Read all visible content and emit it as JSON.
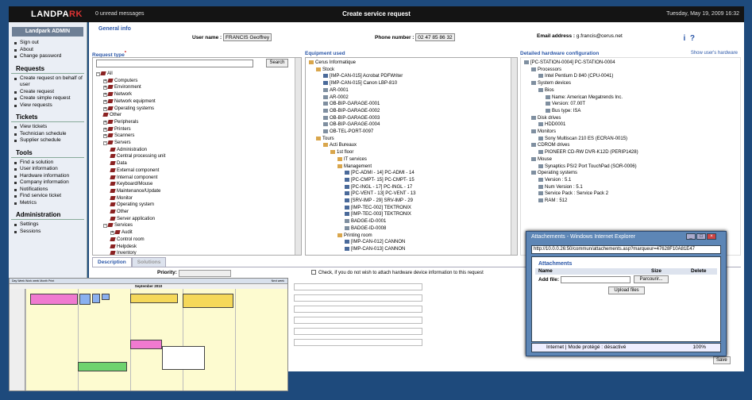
{
  "topbar": {
    "logo_a": "LANDPA",
    "logo_b": "RK",
    "unread": "0 unread messages",
    "title": "Create service request",
    "date": "Tuesday, May 19, 2009",
    "time": "16:32"
  },
  "sidebar": {
    "title": "Landpark ADMIN",
    "account": [
      "Sign out",
      "About",
      "Change password"
    ],
    "requests_title": "Requests",
    "requests": [
      "Create request on behalf of user",
      "Create request",
      "Create simple request",
      "View requests"
    ],
    "tickets_title": "Tickets",
    "tickets": [
      "View tickets",
      "Technician schedule",
      "Supplier schedule"
    ],
    "tools_title": "Tools",
    "tools": [
      "Find a solution",
      "User information",
      "Hardware information",
      "Company information",
      "Notifications",
      "Find service ticket",
      "Metrics"
    ],
    "admin_title": "Administration",
    "admin": [
      "Settings",
      "Sessions"
    ]
  },
  "general": {
    "label": "General info",
    "user_label": "User name :",
    "user_value": "FRANCIS Geoffrey",
    "phone_label": "Phone number :",
    "phone_value": "02 47 85 86 32",
    "email_label": "Email address :",
    "email_value": "g.francis@cerus.net",
    "info_icon": "i",
    "help_icon": "?"
  },
  "request_type": {
    "title": "Request type",
    "required": "*",
    "search_btn": "Search",
    "items": [
      {
        "t": "All",
        "l": 0,
        "pm": "-"
      },
      {
        "t": "Computers",
        "l": 1,
        "pm": "+"
      },
      {
        "t": "Environment",
        "l": 1,
        "pm": "+"
      },
      {
        "t": "Network",
        "l": 1,
        "pm": "+"
      },
      {
        "t": "Network equipment",
        "l": 1,
        "pm": "+"
      },
      {
        "t": "Operating systems",
        "l": 1,
        "pm": "+"
      },
      {
        "t": "Other",
        "l": 1,
        "pm": ""
      },
      {
        "t": "Peripherals",
        "l": 1,
        "pm": "+"
      },
      {
        "t": "Printers",
        "l": 1,
        "pm": "+"
      },
      {
        "t": "Scanners",
        "l": 1,
        "pm": "+"
      },
      {
        "t": "Servers",
        "l": 1,
        "pm": "-"
      },
      {
        "t": "Administration",
        "l": 2,
        "pm": ""
      },
      {
        "t": "Central processing unit",
        "l": 2,
        "pm": ""
      },
      {
        "t": "Data",
        "l": 2,
        "pm": ""
      },
      {
        "t": "External component",
        "l": 2,
        "pm": ""
      },
      {
        "t": "Internal component",
        "l": 2,
        "pm": ""
      },
      {
        "t": "Keyboard/Mouse",
        "l": 2,
        "pm": ""
      },
      {
        "t": "Maintenance/Update",
        "l": 2,
        "pm": ""
      },
      {
        "t": "Monitor",
        "l": 2,
        "pm": ""
      },
      {
        "t": "Operating system",
        "l": 2,
        "pm": ""
      },
      {
        "t": "Other",
        "l": 2,
        "pm": ""
      },
      {
        "t": "Server application",
        "l": 2,
        "pm": ""
      },
      {
        "t": "Services",
        "l": 1,
        "pm": "-"
      },
      {
        "t": "Audit",
        "l": 2,
        "pm": "+"
      },
      {
        "t": "Control room",
        "l": 2,
        "pm": ""
      },
      {
        "t": "Helpdesk",
        "l": 2,
        "pm": ""
      },
      {
        "t": "Inventory",
        "l": 2,
        "pm": ""
      }
    ]
  },
  "equipment": {
    "title": "Equipment used",
    "items": [
      {
        "t": "Cerus Informatique",
        "l": 0,
        "ic": "fold"
      },
      {
        "t": "Stock",
        "l": 1,
        "ic": "fold"
      },
      {
        "t": "[IMP-CAN-015] Acrobat PDFWriter",
        "l": 2,
        "ic": "pc"
      },
      {
        "t": "[IMP-CAN-015] Canon LBP-810",
        "l": 2,
        "ic": "pc"
      },
      {
        "t": "AR-0001",
        "l": 2,
        "ic": "hw"
      },
      {
        "t": "AR-0002",
        "l": 2,
        "ic": "hw"
      },
      {
        "t": "OB-BIP-GARAGE-0001",
        "l": 2,
        "ic": "hw"
      },
      {
        "t": "OB-BIP-GARAGE-0002",
        "l": 2,
        "ic": "hw"
      },
      {
        "t": "OB-BIP-GARAGE-0003",
        "l": 2,
        "ic": "hw"
      },
      {
        "t": "OB-BIP-GARAGE-0004",
        "l": 2,
        "ic": "hw"
      },
      {
        "t": "OB-TEL-PORT-0097",
        "l": 2,
        "ic": "hw"
      },
      {
        "t": "Tours",
        "l": 1,
        "ic": "fold"
      },
      {
        "t": "Acti Bureaux",
        "l": 2,
        "ic": "fold"
      },
      {
        "t": "1st floor",
        "l": 3,
        "ic": "fold"
      },
      {
        "t": "IT services",
        "l": 4,
        "ic": "fold"
      },
      {
        "t": "Management",
        "l": 4,
        "ic": "fold"
      },
      {
        "t": "[PC-ADMI - 14] PC-ADMI - 14",
        "l": 5,
        "ic": "pc"
      },
      {
        "t": "[PC-CMPT- 15] PC-CMPT- 15",
        "l": 5,
        "ic": "pc"
      },
      {
        "t": "[PC-INGL - 17] PC-INGL - 17",
        "l": 5,
        "ic": "pc"
      },
      {
        "t": "[PC-VENT - 13] PC-VENT - 13",
        "l": 5,
        "ic": "pc"
      },
      {
        "t": "[SRV-IMP - 29] SRV-IMP - 29",
        "l": 5,
        "ic": "pc"
      },
      {
        "t": "[IMP-TEC-002] TEKTRONIX",
        "l": 5,
        "ic": "pc"
      },
      {
        "t": "[IMP-TEC-003] TEKTRONIX",
        "l": 5,
        "ic": "pc"
      },
      {
        "t": "BADGE-ID-0001",
        "l": 5,
        "ic": "hw"
      },
      {
        "t": "BADGE-ID-0008",
        "l": 5,
        "ic": "hw"
      },
      {
        "t": "Printing room",
        "l": 4,
        "ic": "fold"
      },
      {
        "t": "[IMP-CAN-012] CANNON",
        "l": 5,
        "ic": "pc"
      },
      {
        "t": "[IMP-CAN-013] CANNON",
        "l": 5,
        "ic": "pc"
      }
    ]
  },
  "hardware": {
    "title": "Detailed hardware configuration",
    "show_link": "Show user's hardware",
    "items": [
      {
        "t": "[PC-STATION-0004] PC-STATION-0004",
        "l": 0
      },
      {
        "t": "Processors",
        "l": 1
      },
      {
        "t": "Intel Pentium D 840 (CPU-0041)",
        "l": 2
      },
      {
        "t": "System devices",
        "l": 1
      },
      {
        "t": "Bios",
        "l": 2
      },
      {
        "t": "Name: American Megatrends Inc.",
        "l": 3
      },
      {
        "t": "Version: 07.00T",
        "l": 3
      },
      {
        "t": "Bus type: ISA",
        "l": 3
      },
      {
        "t": "Disk drives",
        "l": 1
      },
      {
        "t": "HDD0001",
        "l": 2
      },
      {
        "t": "Monitors",
        "l": 1
      },
      {
        "t": "Sony Multiscan 210 ES (ECRAN-0015)",
        "l": 2
      },
      {
        "t": "CDROM drives",
        "l": 1
      },
      {
        "t": "PIONEER CD-RW DVR-K12D (PERIP1428)",
        "l": 2
      },
      {
        "t": "Mouse",
        "l": 1
      },
      {
        "t": "Synaptics PS/2 Port TouchPad (SOR-0006)",
        "l": 2
      },
      {
        "t": "Operating systems",
        "l": 1
      },
      {
        "t": "Version : 5.1",
        "l": 2
      },
      {
        "t": "Num Version : 5.1",
        "l": 2
      },
      {
        "t": "Service Pack : Service Pack 2",
        "l": 2
      },
      {
        "t": "RAM : 512",
        "l": 2
      }
    ]
  },
  "tabs": {
    "description": "Description",
    "solutions": "Solutions"
  },
  "form": {
    "priority_label": "Priority:",
    "checkbox_label": "Check, if you do not wish to attach hardware device information to this request",
    "save": "Save"
  },
  "calendar": {
    "month": "September 2010",
    "toolbar": "Day  Week  Work week  Month  Print",
    "next": "Next week"
  },
  "ie": {
    "title": "Attachements - Windows Internet Explorer",
    "url": "http://10.0.0.26:50/commun/attachements.asp?marqueur=47628F10A81E47",
    "heading": "Attachments",
    "col_name": "Name",
    "col_size": "Size",
    "col_delete": "Delete",
    "add_label": "Add file:",
    "browse": "Parcourir...",
    "upload": "Upload files",
    "status": "Internet | Mode protégé : désactivé",
    "zoom": "100%"
  }
}
